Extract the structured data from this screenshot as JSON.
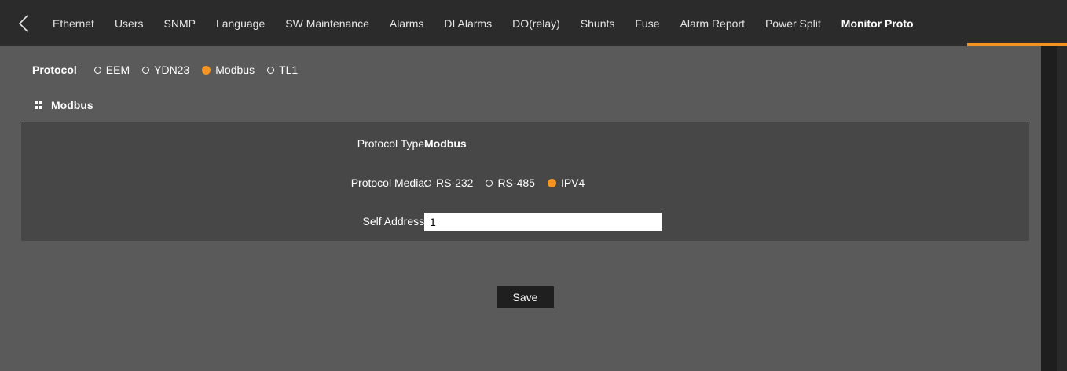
{
  "tabs": [
    {
      "label": "Ethernet"
    },
    {
      "label": "Users"
    },
    {
      "label": "SNMP"
    },
    {
      "label": "Language"
    },
    {
      "label": "SW Maintenance"
    },
    {
      "label": "Alarms"
    },
    {
      "label": "DI Alarms"
    },
    {
      "label": "DO(relay)"
    },
    {
      "label": "Shunts"
    },
    {
      "label": "Fuse"
    },
    {
      "label": "Alarm Report"
    },
    {
      "label": "Power Split"
    },
    {
      "label": "Monitor Proto",
      "active": true
    }
  ],
  "protocol": {
    "label": "Protocol",
    "options": [
      "EEM",
      "YDN23",
      "Modbus",
      "TL1"
    ],
    "selected": "Modbus"
  },
  "section": {
    "title": "Modbus"
  },
  "form": {
    "protocol_type_label": "Protocol Type:",
    "protocol_type_value": "Modbus",
    "protocol_media_label": "Protocol Media:",
    "media_options": [
      "RS-232",
      "RS-485",
      "IPV4"
    ],
    "media_selected": "IPV4",
    "self_address_label": "Self Address:",
    "self_address_value": "1"
  },
  "save_label": "Save",
  "colors": {
    "accent": "#f7941d",
    "tabbar": "#2b2b2b",
    "background": "#5a5a5a",
    "panel": "#474747"
  }
}
